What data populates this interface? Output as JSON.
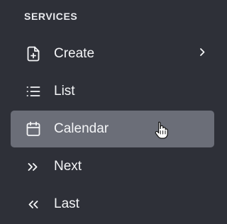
{
  "section": {
    "title": "SERVICES"
  },
  "menu": {
    "items": [
      {
        "label": "Create",
        "icon": "file-plus-icon",
        "has_submenu": true,
        "active": false
      },
      {
        "label": "List",
        "icon": "list-icon",
        "has_submenu": false,
        "active": false
      },
      {
        "label": "Calendar",
        "icon": "calendar-icon",
        "has_submenu": false,
        "active": true
      },
      {
        "label": "Next",
        "icon": "double-chevron-right-icon",
        "has_submenu": false,
        "active": false
      },
      {
        "label": "Last",
        "icon": "double-chevron-left-icon",
        "has_submenu": false,
        "active": false
      }
    ]
  },
  "colors": {
    "background": "#2e3038",
    "active_item": "#6b6e78",
    "text": "#f4f5f7"
  }
}
